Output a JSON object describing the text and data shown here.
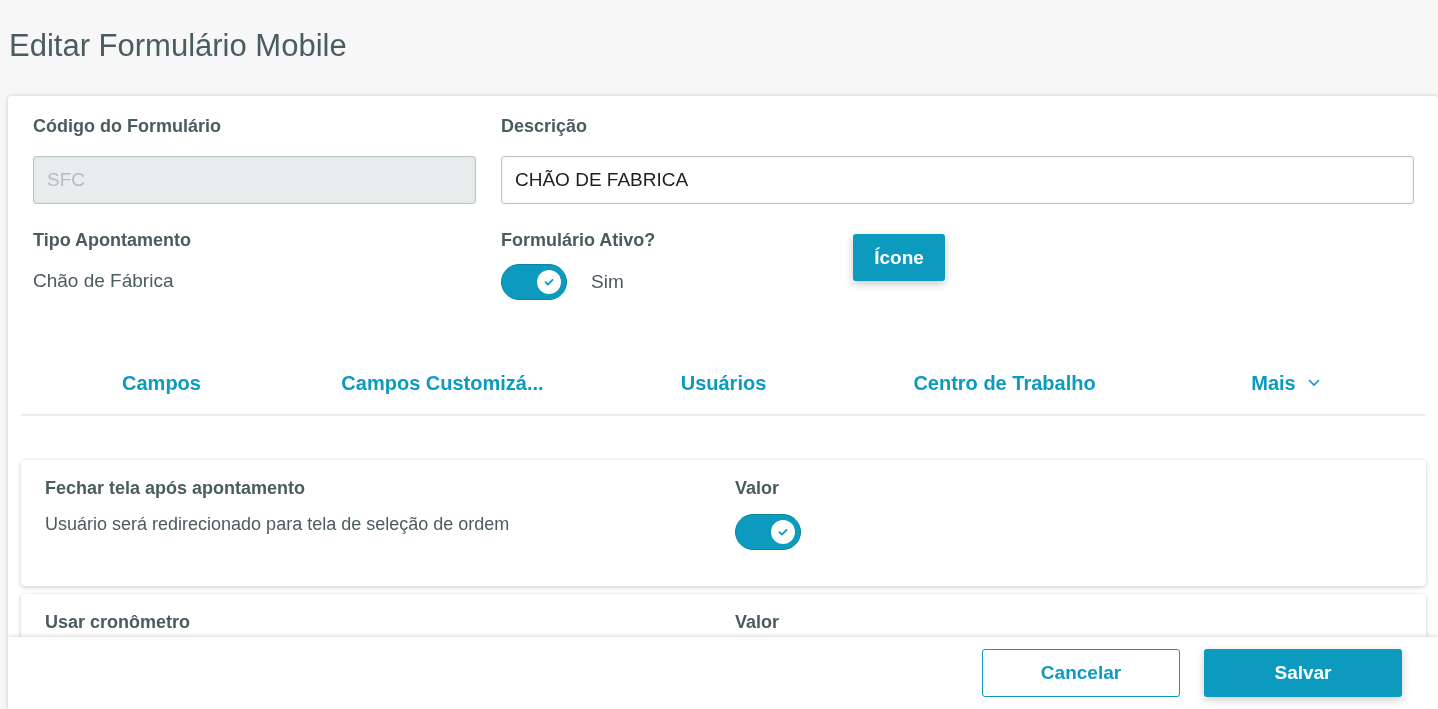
{
  "page": {
    "title": "Editar Formulário Mobile"
  },
  "form": {
    "code": {
      "label": "Código do Formulário",
      "value": "SFC",
      "disabled": true
    },
    "description": {
      "label": "Descrição",
      "value": "CHÃO DE FABRICA"
    },
    "type": {
      "label": "Tipo Apontamento",
      "value": "Chão de Fábrica"
    },
    "active": {
      "label": "Formulário Ativo?",
      "on": true,
      "text": "Sim"
    },
    "icon_button": "Ícone"
  },
  "tabs": [
    {
      "label": "Campos"
    },
    {
      "label": "Campos Customizá..."
    },
    {
      "label": "Usuários"
    },
    {
      "label": "Centro de Trabalho"
    },
    {
      "label": "Mais",
      "kind": "menu"
    }
  ],
  "settings": [
    {
      "title": "Fechar tela após apontamento",
      "description": "Usuário será redirecionado para tela de seleção de ordem",
      "value_label": "Valor",
      "on": true
    },
    {
      "title": "Usar cronômetro",
      "value_label": "Valor"
    }
  ],
  "footer": {
    "buttons": [
      {
        "label": "Cancelar",
        "kind": "secondary"
      },
      {
        "label": "Salvar",
        "kind": "primary"
      }
    ]
  }
}
